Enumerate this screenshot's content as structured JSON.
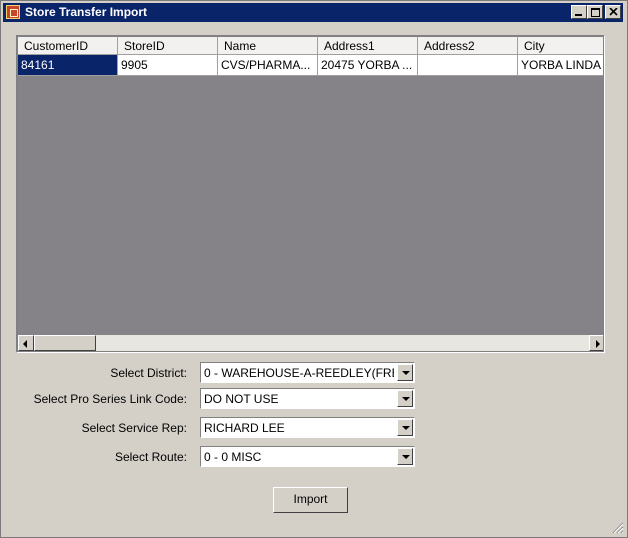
{
  "window": {
    "title": "Store Transfer Import"
  },
  "grid": {
    "columns": [
      "CustomerID",
      "StoreID",
      "Name",
      "Address1",
      "Address2",
      "City"
    ],
    "rows": [
      [
        "84161",
        "9905",
        "CVS/PHARMA...",
        "20475 YORBA ...",
        "",
        "YORBA LINDA"
      ]
    ]
  },
  "form": {
    "district": {
      "label": "Select District:",
      "value": "0 - WAREHOUSE-A-REEDLEY(FRE"
    },
    "link_code": {
      "label": "Select Pro Series Link Code:",
      "value": "DO NOT USE"
    },
    "service_rep": {
      "label": "Select Service Rep:",
      "value": "RICHARD LEE"
    },
    "route": {
      "label": "Select Route:",
      "value": "0 - 0 MISC"
    },
    "import_label": "Import"
  },
  "icons": {
    "app": "app-icon",
    "minimize": "minimize-icon",
    "maximize": "maximize-icon",
    "close": "close-icon",
    "scroll_left": "arrow-left-icon",
    "scroll_right": "arrow-right-icon",
    "dropdown": "chevron-down-icon",
    "grip": "resize-grip-icon"
  },
  "colors": {
    "titlebar": "#0a246a",
    "selection": "#0a246a",
    "window_bg": "#d4d0c8",
    "grid_bg": "#858388"
  }
}
